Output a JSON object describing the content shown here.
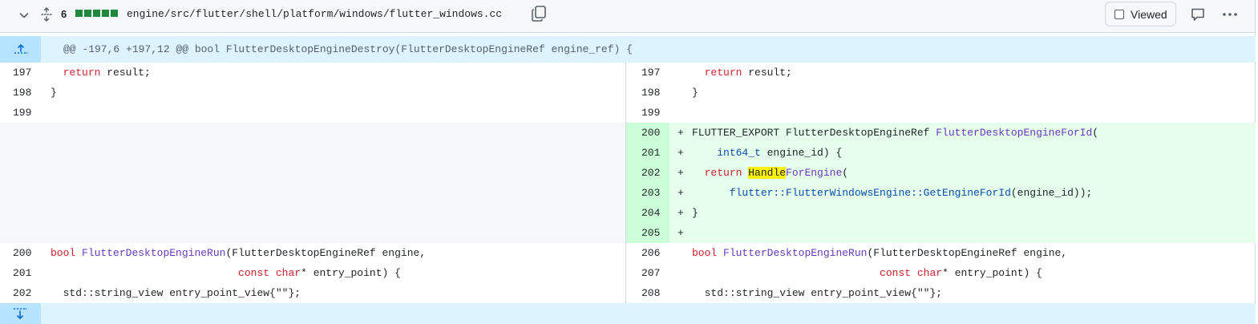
{
  "header": {
    "change_count": "6",
    "file_path": "engine/src/flutter/shell/platform/windows/flutter_windows.cc",
    "viewed_label": "Viewed",
    "colors": {
      "bar": "#1f883d",
      "added_bg": "#e6ffec",
      "added_gutter": "#ccffd8",
      "hunk_bg": "#ddf4ff"
    }
  },
  "hunk": {
    "header": "@@ -197,6 +197,12 @@ bool FlutterDesktopEngineDestroy(FlutterDesktopEngineRef engine_ref) {"
  },
  "rows": {
    "r1": {
      "left_num": "197",
      "right_num": "197"
    },
    "r2": {
      "left_num": "198",
      "right_num": "198"
    },
    "r3": {
      "left_num": "199",
      "right_num": "199"
    },
    "a1": {
      "right_num": "200"
    },
    "a2": {
      "right_num": "201"
    },
    "a3": {
      "right_num": "202"
    },
    "a4": {
      "right_num": "203"
    },
    "a5": {
      "right_num": "204"
    },
    "a6": {
      "right_num": "205"
    },
    "c1": {
      "left_num": "200",
      "right_num": "206"
    },
    "c2": {
      "left_num": "201",
      "right_num": "207"
    },
    "c3": {
      "left_num": "202",
      "right_num": "208"
    }
  },
  "tokens": {
    "return": "return",
    "result": " result;",
    "brace_close": "}",
    "plus": "+",
    "export": "FLUTTER_EXPORT FlutterDesktopEngineRef ",
    "for_id_fn": "FlutterDesktopEngineForId",
    "paren_open": "(",
    "int64": "int64_t",
    "engine_id_param": " engine_id) {",
    "handle": "Handle",
    "for_engine": "ForEngine",
    "flutter_ns": "flutter::FlutterWindowsEngine::GetEngineForId",
    "engine_id_call": "(engine_id));",
    "bool": "bool",
    "run_fn": "FlutterDesktopEngineRun",
    "run_params": "(FlutterDesktopEngineRef engine,",
    "const": "const",
    "char": "char",
    "entry_point": "* entry_point) {",
    "string_view": "std::string_view entry_point_view{\"\"};"
  }
}
